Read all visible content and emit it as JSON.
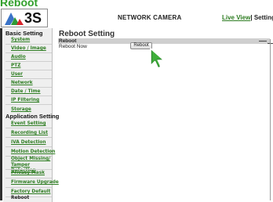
{
  "caption": "Reboot",
  "header": {
    "logo_text": "3S",
    "title": "NETWORK CAMERA",
    "nav": {
      "live_view": "Live View",
      "separator": "|",
      "setting": "Setting"
    }
  },
  "sidebar": {
    "basic_heading": "Basic Setting",
    "basic_items": [
      "System",
      "Video / Image",
      "Audio",
      "PTZ",
      "User",
      "Network",
      "Date / Time",
      "IP Filtering",
      "Storage"
    ],
    "app_heading": "Application Setting",
    "app_items": [
      "Event Setting",
      "Recording List",
      "IVA Detection",
      "Motion Detection",
      "Object Missing/ Tamper Detection",
      "Privacy Mask",
      "Firmware Upgrade",
      "Factory Default",
      "Reboot"
    ],
    "current": "Reboot"
  },
  "main": {
    "title": "Reboot Setting",
    "section_label": "Reboot",
    "row_label": "Reboot Now",
    "button_label": "Reboot"
  },
  "colors": {
    "link": "#2e7d22",
    "caption": "#32a02c",
    "sidebar_bg": "#efefef",
    "section_bar": "#cfcfcf"
  },
  "icons": [
    "logo-triangles-icon",
    "mouse-pointer-icon"
  ]
}
